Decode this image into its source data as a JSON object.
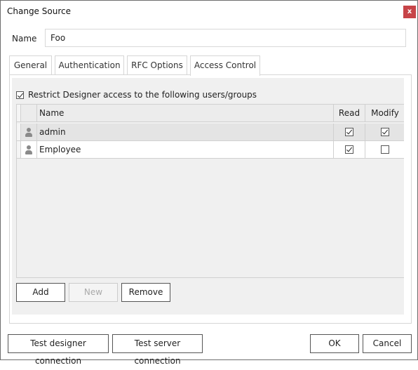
{
  "window": {
    "title": "Change Source",
    "close_label": "x"
  },
  "name_field": {
    "label": "Name",
    "value": "Foo"
  },
  "tabs": [
    {
      "label": "General",
      "active": false
    },
    {
      "label": "Authentication",
      "active": false
    },
    {
      "label": "RFC Options",
      "active": false
    },
    {
      "label": "Access Control",
      "active": true
    }
  ],
  "access_control": {
    "restrict_label": "Restrict Designer access to the following users/groups",
    "restrict_checked": true,
    "columns": {
      "name": "Name",
      "read": "Read",
      "modify": "Modify"
    },
    "rows": [
      {
        "icon": "user-icon",
        "name": "admin",
        "read": true,
        "modify": true
      },
      {
        "icon": "user-icon",
        "name": "Employee",
        "read": true,
        "modify": false
      }
    ],
    "buttons": {
      "add": "Add",
      "new": "New",
      "remove": "Remove"
    }
  },
  "footer": {
    "test_designer": "Test designer connection",
    "test_server": "Test server connection",
    "ok": "OK",
    "cancel": "Cancel"
  }
}
